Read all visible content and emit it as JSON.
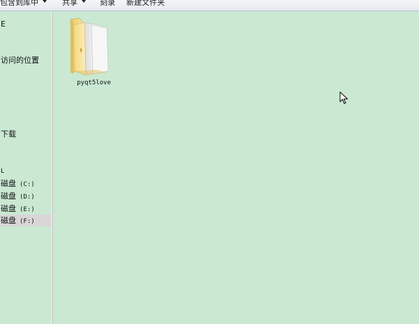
{
  "toolbar": {
    "include_label": "包含到库中",
    "share_label": "共享",
    "burn_label": "刻录",
    "new_folder_label": "新建文件夹"
  },
  "nav": {
    "fav_partial": "E",
    "recent_places": "访问的位置",
    "downloads": "下载",
    "computer_partial": "L",
    "drives": [
      {
        "label": "磁盘",
        "letter": "(C:)"
      },
      {
        "label": "磁盘",
        "letter": "(D:)"
      },
      {
        "label": "磁盘",
        "letter": "(E:)"
      },
      {
        "label": "磁盘",
        "letter": "(F:)",
        "selected": true
      }
    ]
  },
  "content": {
    "items": [
      {
        "name": "pyqt5love",
        "type": "folder"
      }
    ]
  },
  "colors": {
    "pane_background": "#cae8d2",
    "selected_item": "#d8d6d6"
  }
}
